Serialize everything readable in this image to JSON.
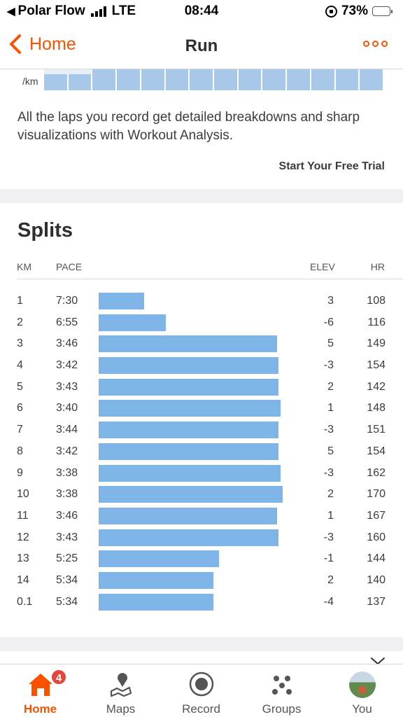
{
  "status": {
    "carrier": "Polar Flow",
    "network": "LTE",
    "time": "08:44",
    "battery": "73%"
  },
  "nav": {
    "back_label": "Home",
    "title": "Run"
  },
  "pace_strip": {
    "unit_label": "/km"
  },
  "promo": {
    "text": "All the laps you record get detailed breakdowns and sharp visualizations with Workout Analysis.",
    "trial_label": "Start Your Free Trial"
  },
  "splits": {
    "title": "Splits",
    "headers": {
      "km": "KM",
      "pace": "PACE",
      "elev": "ELEV",
      "hr": "HR"
    },
    "rows": [
      {
        "km": "1",
        "pace": "7:30",
        "elev": "3",
        "hr": "108",
        "speed_ratio": 0.25
      },
      {
        "km": "2",
        "pace": "6:55",
        "elev": "-6",
        "hr": "116",
        "speed_ratio": 0.37
      },
      {
        "km": "3",
        "pace": "3:46",
        "elev": "5",
        "hr": "149",
        "speed_ratio": 0.98
      },
      {
        "km": "4",
        "pace": "3:42",
        "elev": "-3",
        "hr": "154",
        "speed_ratio": 0.99
      },
      {
        "km": "5",
        "pace": "3:43",
        "elev": "2",
        "hr": "142",
        "speed_ratio": 0.99
      },
      {
        "km": "6",
        "pace": "3:40",
        "elev": "1",
        "hr": "148",
        "speed_ratio": 1.0
      },
      {
        "km": "7",
        "pace": "3:44",
        "elev": "-3",
        "hr": "151",
        "speed_ratio": 0.99
      },
      {
        "km": "8",
        "pace": "3:42",
        "elev": "5",
        "hr": "154",
        "speed_ratio": 0.99
      },
      {
        "km": "9",
        "pace": "3:38",
        "elev": "-3",
        "hr": "162",
        "speed_ratio": 1.0
      },
      {
        "km": "10",
        "pace": "3:38",
        "elev": "2",
        "hr": "170",
        "speed_ratio": 1.01
      },
      {
        "km": "11",
        "pace": "3:46",
        "elev": "1",
        "hr": "167",
        "speed_ratio": 0.98
      },
      {
        "km": "12",
        "pace": "3:43",
        "elev": "-3",
        "hr": "160",
        "speed_ratio": 0.99
      },
      {
        "km": "13",
        "pace": "5:25",
        "elev": "-1",
        "hr": "144",
        "speed_ratio": 0.66
      },
      {
        "km": "14",
        "pace": "5:34",
        "elev": "2",
        "hr": "140",
        "speed_ratio": 0.63
      },
      {
        "km": "0.1",
        "pace": "5:34",
        "elev": "-4",
        "hr": "137",
        "speed_ratio": 0.63
      }
    ]
  },
  "tabbar": {
    "tabs": [
      {
        "label": "Home",
        "badge": "4",
        "active": true
      },
      {
        "label": "Maps"
      },
      {
        "label": "Record"
      },
      {
        "label": "Groups"
      },
      {
        "label": "You"
      }
    ]
  },
  "colors": {
    "accent": "#fc5200",
    "split_bar": "#7eb4e8",
    "pace_strip": "#a8c8ea",
    "badge": "#e5483b"
  }
}
